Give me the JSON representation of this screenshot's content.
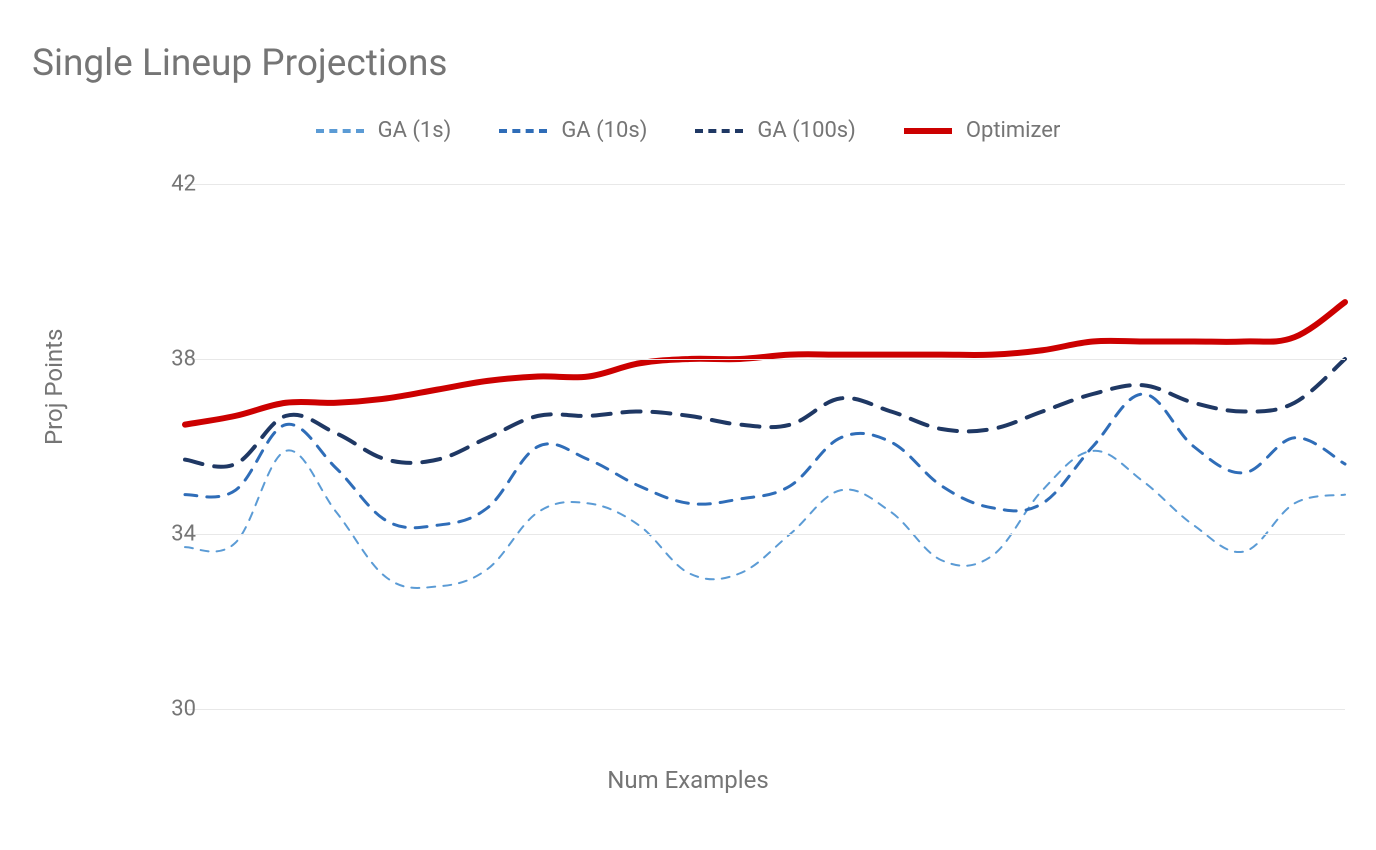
{
  "chart_data": {
    "type": "line",
    "title": "Single Lineup Projections",
    "xlabel": "Num Examples",
    "ylabel": "Proj Points",
    "ylim": [
      30,
      42
    ],
    "yticks": [
      30,
      34,
      38,
      42
    ],
    "x": [
      1,
      2,
      3,
      4,
      5,
      6,
      7,
      8,
      9,
      10,
      11,
      12,
      13,
      14,
      15,
      16,
      17,
      18,
      19,
      20,
      21,
      22,
      23,
      24
    ],
    "series": [
      {
        "name": "GA (1s)",
        "color": "#5b9bd5",
        "stroke_width": 2,
        "dash": "8 8",
        "values": [
          33.7,
          33.8,
          35.9,
          34.5,
          33.0,
          32.8,
          33.2,
          34.5,
          34.7,
          34.2,
          33.1,
          33.1,
          34.0,
          35.0,
          34.5,
          33.4,
          33.5,
          35.0,
          35.9,
          35.2,
          34.2,
          33.6,
          34.7,
          34.9
        ]
      },
      {
        "name": "GA (10s)",
        "color": "#2f6db8",
        "stroke_width": 3,
        "dash": "12 10",
        "values": [
          34.9,
          35.0,
          36.5,
          35.5,
          34.3,
          34.2,
          34.6,
          36.0,
          35.7,
          35.1,
          34.7,
          34.8,
          35.1,
          36.2,
          36.1,
          35.1,
          34.6,
          34.7,
          36.0,
          37.2,
          36.0,
          35.4,
          36.2,
          35.6
        ]
      },
      {
        "name": "GA (100s)",
        "color": "#1f3864",
        "stroke_width": 4,
        "dash": "18 12",
        "values": [
          35.7,
          35.6,
          36.7,
          36.3,
          35.7,
          35.7,
          36.2,
          36.7,
          36.7,
          36.8,
          36.7,
          36.5,
          36.5,
          37.1,
          36.8,
          36.4,
          36.4,
          36.8,
          37.2,
          37.4,
          37.0,
          36.8,
          37.0,
          38.0
        ]
      },
      {
        "name": "Optimizer",
        "color": "#cc0000",
        "stroke_width": 6,
        "dash": null,
        "values": [
          36.5,
          36.7,
          37.0,
          37.0,
          37.1,
          37.3,
          37.5,
          37.6,
          37.6,
          37.9,
          38.0,
          38.0,
          38.1,
          38.1,
          38.1,
          38.1,
          38.1,
          38.2,
          38.4,
          38.4,
          38.4,
          38.4,
          38.5,
          39.3
        ]
      }
    ],
    "legend_position": "top"
  }
}
